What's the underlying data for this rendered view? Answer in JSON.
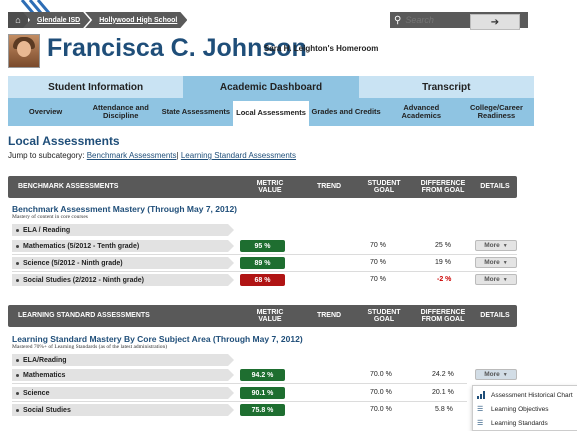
{
  "breadcrumb": {
    "district": "Glendale ISD",
    "school": "Hollywood High School"
  },
  "search": {
    "placeholder": "Search",
    "go_label": "➔"
  },
  "student": {
    "name": "Francisca C. Johnson",
    "homeroom": "Sara H. Leighton's Homeroom"
  },
  "main_tabs": [
    {
      "label": "Student Information",
      "active": false
    },
    {
      "label": "Academic Dashboard",
      "active": true
    },
    {
      "label": "Transcript",
      "active": false
    }
  ],
  "sub_tabs": [
    {
      "label": "Overview",
      "active": false
    },
    {
      "label": "Attendance and Discipline",
      "active": false
    },
    {
      "label": "State Assessments",
      "active": false
    },
    {
      "label": "Local Assessments",
      "active": true
    },
    {
      "label": "Grades and Credits",
      "active": false
    },
    {
      "label": "Advanced Academics",
      "active": false
    },
    {
      "label": "College/Career Readiness",
      "active": false
    }
  ],
  "section": {
    "title": "Local Assessments",
    "jump_prefix": "Jump to subcategory:",
    "jump_links": [
      "Benchmark Assessments",
      "Learning Standard Assessments"
    ]
  },
  "benchmark": {
    "header": [
      "BENCHMARK ASSESSMENTS",
      "METRIC VALUE",
      "TREND",
      "STUDENT GOAL",
      "DIFFERENCE FROM GOAL",
      "DETAILS"
    ],
    "group_title": "Benchmark Assessment Mastery  (Through May 7, 2012)",
    "group_subtitle": "Mastery of content in core courses",
    "category": "ELA / Reading",
    "rows": [
      {
        "label": "Mathematics  (5/2012 - Tenth grade)",
        "metric": "95 %",
        "status": "green",
        "goal": "70 %",
        "diff": "25 %",
        "more": "More"
      },
      {
        "label": "Science  (5/2012 - Ninth grade)",
        "metric": "89 %",
        "status": "green",
        "goal": "70 %",
        "diff": "19 %",
        "more": "More"
      },
      {
        "label": "Social Studies  (2/2012 - Ninth grade)",
        "metric": "68 %",
        "status": "red",
        "goal": "70 %",
        "diff": "-2 %",
        "more": "More"
      }
    ]
  },
  "learning": {
    "header": [
      "LEARNING STANDARD ASSESSMENTS",
      "METRIC VALUE",
      "TREND",
      "STUDENT GOAL",
      "DIFFERENCE FROM GOAL",
      "DETAILS"
    ],
    "group_title": "Learning Standard Mastery By Core Subject Area  (Through May 7, 2012)",
    "group_subtitle": "Mastered 70%+ of Learning Standards (as of the latest administration)",
    "category": "ELA/Reading",
    "rows": [
      {
        "label": "Mathematics",
        "metric": "94.2 %",
        "status": "green",
        "goal": "70.0 %",
        "diff": "24.2 %",
        "more": "More"
      },
      {
        "label": "Science",
        "metric": "90.1 %",
        "status": "green",
        "goal": "70.0 %",
        "diff": "20.1 %",
        "more": ""
      },
      {
        "label": "Social Studies",
        "metric": "75.8 %",
        "status": "green",
        "goal": "70.0 %",
        "diff": "5.8 %",
        "more": ""
      }
    ]
  },
  "more_menu": {
    "items": [
      {
        "label": "Assessment Historical Chart",
        "icon": "bar-chart-icon"
      },
      {
        "label": "Learning Objectives",
        "icon": "list-icon"
      },
      {
        "label": "Learning Standards",
        "icon": "list-icon"
      }
    ]
  },
  "colors": {
    "brand_blue": "#1f4e79",
    "good": "#1e6e30",
    "bad": "#b01414",
    "tab_active": "#8fc4e2",
    "tab_inactive": "#c9e3f3"
  }
}
